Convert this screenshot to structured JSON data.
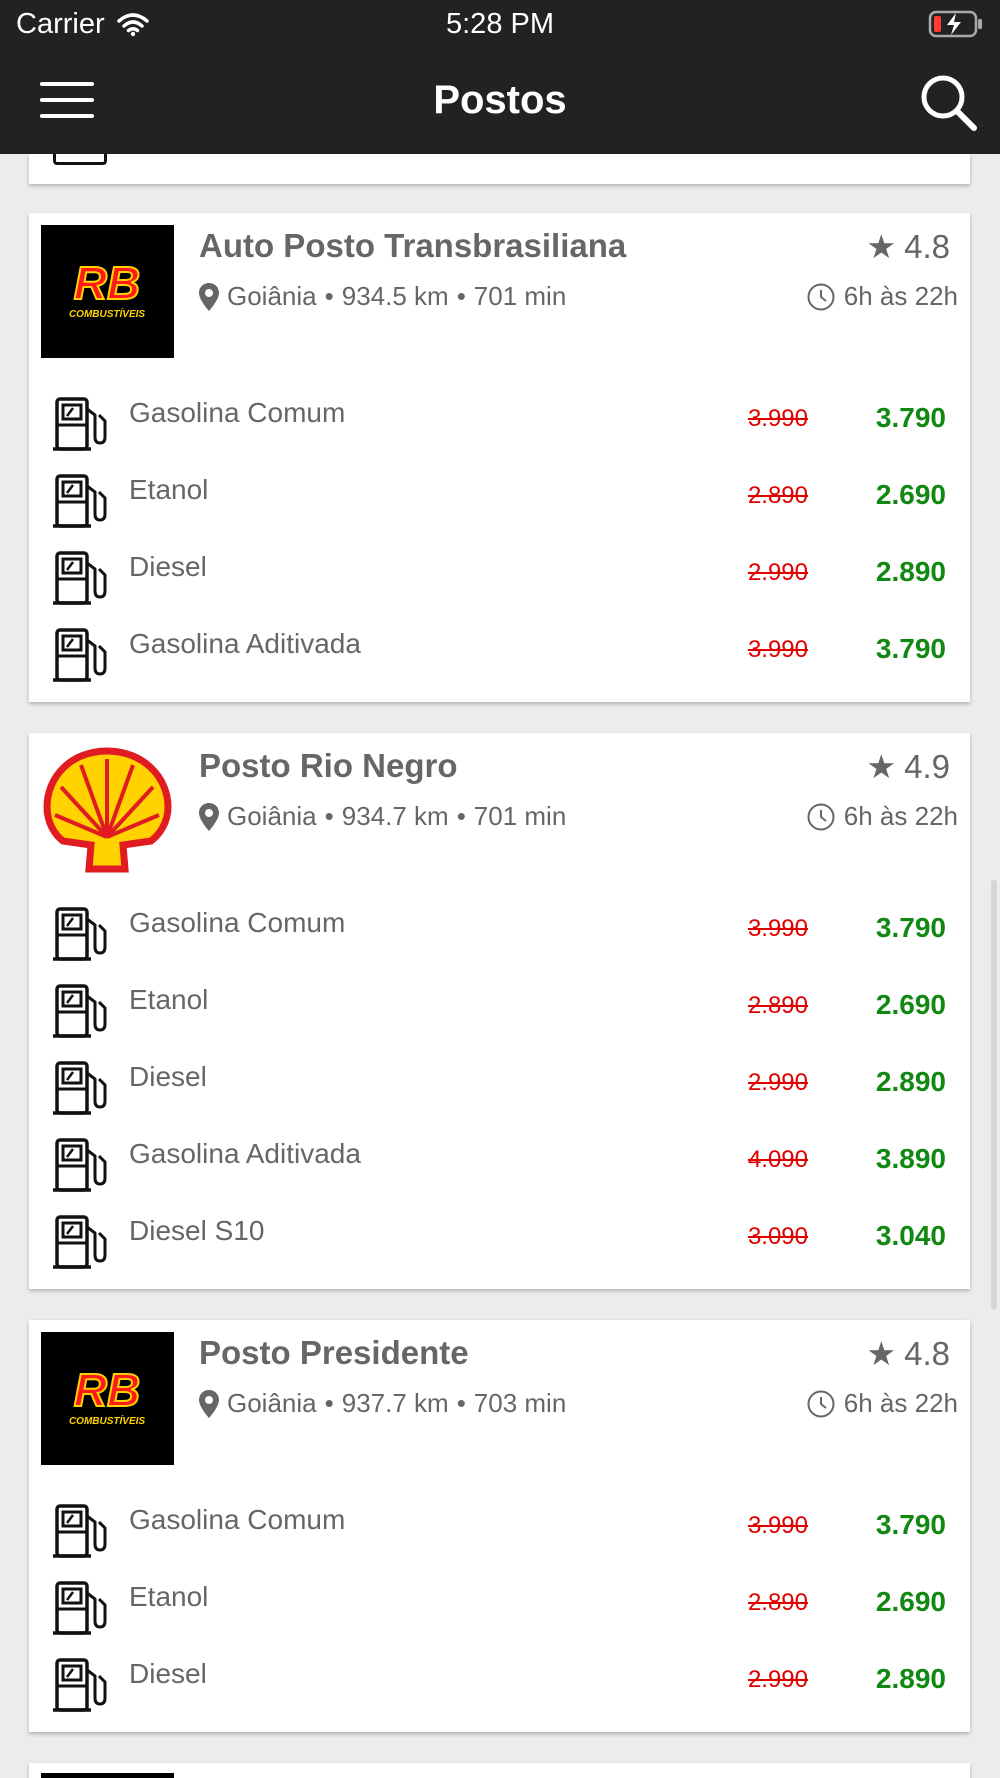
{
  "status_bar": {
    "carrier": "Carrier",
    "time": "5:28 PM"
  },
  "header": {
    "title": "Postos"
  },
  "stations": [
    {
      "name": "Auto Posto Transbrasiliana",
      "logo": "rb-combustiveis-logo",
      "logo_text": "RB",
      "logo_sub": "COMBUSTÍVEIS",
      "city": "Goiânia",
      "distance": "934.5 km",
      "duration": "701 min",
      "rating": "4.8",
      "hours": "6h às 22h",
      "fuels": [
        {
          "name": "Gasolina Comum",
          "old_price": "3.990",
          "new_price": "3.790"
        },
        {
          "name": "Etanol",
          "old_price": "2.890",
          "new_price": "2.690"
        },
        {
          "name": "Diesel",
          "old_price": "2.990",
          "new_price": "2.890"
        },
        {
          "name": "Gasolina Aditivada",
          "old_price": "3.990",
          "new_price": "3.790"
        }
      ]
    },
    {
      "name": "Posto Rio Negro",
      "logo": "shell-logo",
      "city": "Goiânia",
      "distance": "934.7 km",
      "duration": "701 min",
      "rating": "4.9",
      "hours": "6h às 22h",
      "fuels": [
        {
          "name": "Gasolina Comum",
          "old_price": "3.990",
          "new_price": "3.790"
        },
        {
          "name": "Etanol",
          "old_price": "2.890",
          "new_price": "2.690"
        },
        {
          "name": "Diesel",
          "old_price": "2.990",
          "new_price": "2.890"
        },
        {
          "name": "Gasolina Aditivada",
          "old_price": "4.090",
          "new_price": "3.890"
        },
        {
          "name": "Diesel S10",
          "old_price": "3.090",
          "new_price": "3.040"
        }
      ]
    },
    {
      "name": "Posto Presidente",
      "logo": "rb-combustiveis-logo",
      "logo_text": "RB",
      "logo_sub": "COMBUSTÍVEIS",
      "city": "Goiânia",
      "distance": "937.7 km",
      "duration": "703 min",
      "rating": "4.8",
      "hours": "6h às 22h",
      "fuels": [
        {
          "name": "Gasolina Comum",
          "old_price": "3.990",
          "new_price": "3.790"
        },
        {
          "name": "Etanol",
          "old_price": "2.890",
          "new_price": "2.690"
        },
        {
          "name": "Diesel",
          "old_price": "2.990",
          "new_price": "2.890"
        }
      ]
    }
  ],
  "colors": {
    "header_bg": "#222222",
    "old_price": "#e00000",
    "new_price": "#118811",
    "text": "#666666"
  }
}
